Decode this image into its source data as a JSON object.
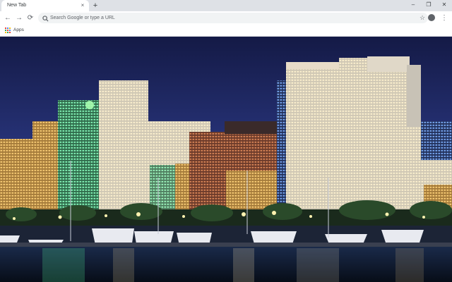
{
  "browser": {
    "tab": {
      "title": "New Tab",
      "close_glyph": "×"
    },
    "new_tab_glyph": "+",
    "window_controls": {
      "minimize": "–",
      "restore": "❐",
      "close": "✕"
    },
    "nav": {
      "back": "←",
      "forward": "→",
      "reload": "⟳"
    },
    "omnibox": {
      "placeholder": "Search Google or type a URL"
    },
    "menu_glyph": "⋮",
    "bookmark_star": "☆",
    "bookmarks_bar": {
      "apps_label": "Apps"
    }
  },
  "wallpaper": {
    "subject": "city-skyline-night-marina"
  },
  "colors": {
    "sky_top": "#141a46",
    "sky_bottom": "#3a4a98",
    "water": "#0c1424"
  }
}
